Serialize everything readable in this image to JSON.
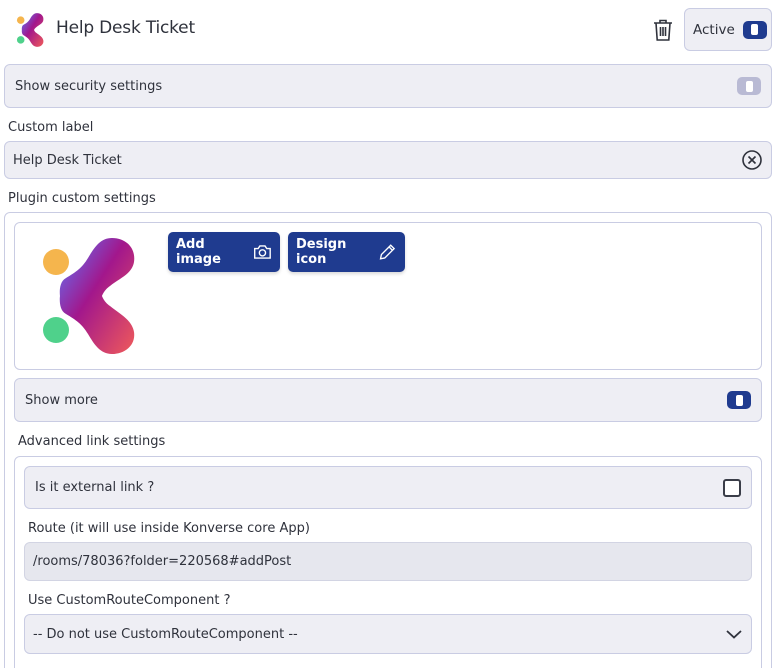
{
  "header": {
    "title": "Help Desk Ticket",
    "active_label": "Active",
    "icons": {
      "logo": "konverse-logo",
      "delete": "trash-icon"
    }
  },
  "security": {
    "label": "Show security settings",
    "enabled": false
  },
  "custom_label": {
    "label": "Custom label",
    "value": "Help Desk Ticket",
    "clear_icon": "clear-circle-icon"
  },
  "plugin_settings": {
    "label": "Plugin custom settings",
    "add_image_label": "Add image",
    "design_icon_label": "Design icon",
    "icons": {
      "add_image": "camera-icon",
      "design_icon": "pencil-icon"
    }
  },
  "show_more": {
    "label": "Show more",
    "enabled": true
  },
  "advanced": {
    "label": "Advanced link settings",
    "external_label": "Is it external link ?",
    "external_checked": false,
    "route_label": "Route (it will use inside Konverse core App)",
    "route_value": "/rooms/78036?folder=220568#addPost",
    "custom_route_label": "Use CustomRouteComponent ?",
    "custom_route_selected": "-- Do not use CustomRouteComponent --"
  },
  "colors": {
    "accent": "#1f3b8f",
    "panel_bg": "#eeeef4",
    "border": "#c9cce3",
    "toggle_off": "#b9bad4",
    "logo_orange": "#f5b54d",
    "logo_green": "#4fd18b",
    "logo_magenta": "#a2178c",
    "logo_blue": "#5b7bff",
    "logo_red": "#ef5a5a"
  }
}
